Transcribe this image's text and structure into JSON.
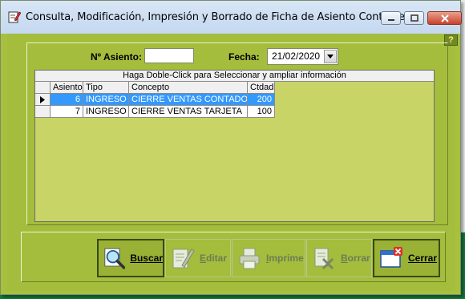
{
  "window": {
    "title": "Consulta, Modificación, Impresión y Borrado de Ficha de Asiento Contable",
    "help_label": "?"
  },
  "form": {
    "asiento_label": "Nº Asiento:",
    "asiento_value": "",
    "fecha_label": "Fecha:",
    "fecha_value": "21/02/2020"
  },
  "grid": {
    "caption": "Haga Doble-Click para Seleccionar y ampliar información",
    "columns": [
      "Asiento",
      "Tipo",
      "Concepto",
      "Ctdad"
    ],
    "rows": [
      {
        "asiento": "6",
        "tipo": "INGRESO",
        "concepto": "CIERRE VENTAS CONTADO",
        "ctdad": "200",
        "selected": true
      },
      {
        "asiento": "7",
        "tipo": "INGRESO",
        "concepto": "CIERRE VENTAS TARJETA",
        "ctdad": "100",
        "selected": false
      }
    ]
  },
  "buttons": {
    "buscar": "Buscar",
    "editar": "Editar",
    "imprime": "Imprime",
    "borrar": "Borrar",
    "cerrar": "Cerrar"
  },
  "colors": {
    "window_bg": "#a7c03d",
    "grid_bg": "#c8d566",
    "selection": "#3399ff",
    "desktop": "#16803d"
  }
}
